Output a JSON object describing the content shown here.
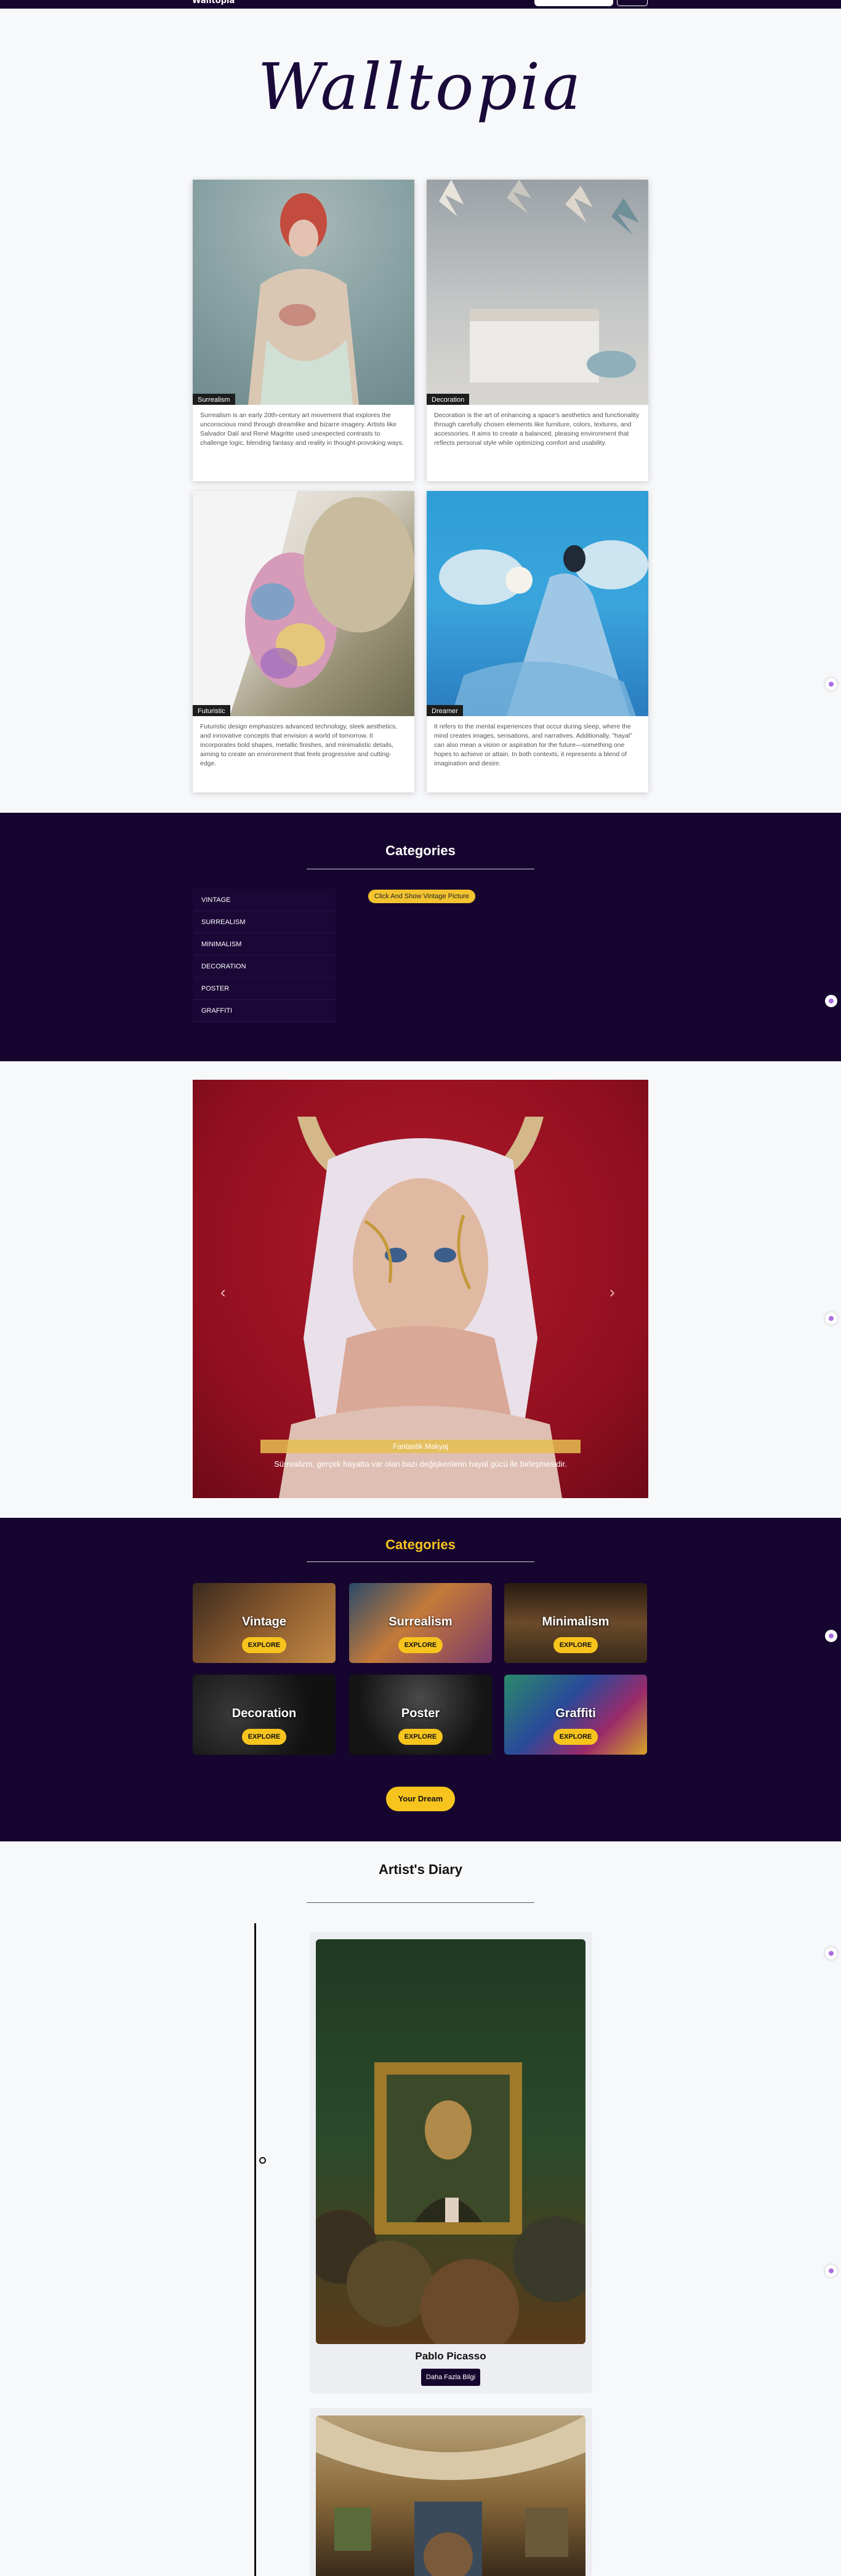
{
  "nav": {
    "brand": "Walltopia"
  },
  "site_title": "Walltopia",
  "cards": [
    {
      "tag": "Surrealism",
      "desc": "Surrealism is an early 20th-century art movement that explores the unconscious mind through dreamlike and bizarre imagery. Artists like Salvador Dalí and René Magritte used unexpected contrasts to challenge logic, blending fantasy and reality in thought-provoking ways."
    },
    {
      "tag": "Decoration",
      "desc": "Decoration is the art of enhancing a space's aesthetics and functionality through carefully chosen elements like furniture, colors, textures, and accessories. It aims to create a balanced, pleasing environment that reflects personal style while optimizing comfort and usability."
    },
    {
      "tag": "Futuristic",
      "desc": "Futuristic design emphasizes advanced technology, sleek aesthetics, and innovative concepts that envision a world of tomorrow. It incorporates bold shapes, metallic finishes, and minimalistic details, aiming to create an environment that feels progressive and cutting-edge."
    },
    {
      "tag": "Dreamer",
      "desc": "It refers to the mental experiences that occur during sleep, where the mind creates images, sensations, and narratives. Additionally, \"hayal\" can also mean a vision or aspiration for the future—something one hopes to achieve or attain. In both contexts, it represents a blend of imagination and desire."
    }
  ],
  "categories_section": {
    "title": "Categories",
    "items": [
      "VINTAGE",
      "SURREALISM",
      "MINIMALISM",
      "DECORATION",
      "POSTER",
      "GRAFFITI"
    ],
    "pill": "Click And Show Vintage Picture"
  },
  "carousel": {
    "prev": "‹",
    "next": "›",
    "band": "Fantastik Makyaj",
    "caption": "Sürrealizm, gerçek hayatta var olan bazı değişkenlerin hayal gücü ile birleşmesidir."
  },
  "tiles_section": {
    "title": "Categories",
    "explore_label": "EXPLORE",
    "tiles": [
      "Vintage",
      "Surrealism",
      "Minimalism",
      "Decoration",
      "Poster",
      "Graffiti"
    ],
    "dream_button": "Your Dream"
  },
  "diary": {
    "title": "Artist's Diary",
    "artist_name": "Pablo Picasso",
    "more_button": "Daha Fazla Bilgi"
  },
  "colors": {
    "dark": "#16052e",
    "accent": "#f7c41e"
  }
}
